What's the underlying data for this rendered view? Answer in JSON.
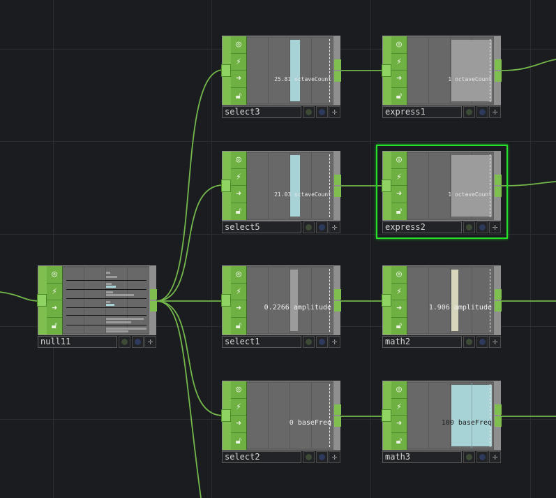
{
  "nodes": {
    "select3": {
      "name": "select3",
      "value": "25.81 octaveCount",
      "bar_color": "#a7d3d7"
    },
    "express1": {
      "name": "express1",
      "value": "1 octaveCount",
      "bar_color": "#9c9c9c"
    },
    "select5": {
      "name": "select5",
      "value": "21.03 octaveCount",
      "bar_color": "#a7d3d7"
    },
    "express2": {
      "name": "express2",
      "value": "1 octaveCount",
      "bar_color": "#9c9c9c"
    },
    "null11": {
      "name": "null11"
    },
    "select1": {
      "name": "select1",
      "value": "0.2266 amplitude",
      "bar_color": "#9c9c9c"
    },
    "math2": {
      "name": "math2",
      "value": "1.906 amplitude",
      "bar_color": "#d7d5bb"
    },
    "select2": {
      "name": "select2",
      "value": "0 baseFreq"
    },
    "math3": {
      "name": "math3",
      "value": "100 baseFreq",
      "bar_color": "#a7d3d7"
    }
  },
  "selected_node": "express2",
  "flag_icons": [
    "viewer-flag-icon",
    "bypass-flag-icon",
    "display-flag-icon",
    "lock-flag-icon"
  ],
  "colors": {
    "background": "#1b1c20",
    "chop_green": "#7fbf4f",
    "wire": "#74b84b",
    "selection": "#27e02b"
  }
}
